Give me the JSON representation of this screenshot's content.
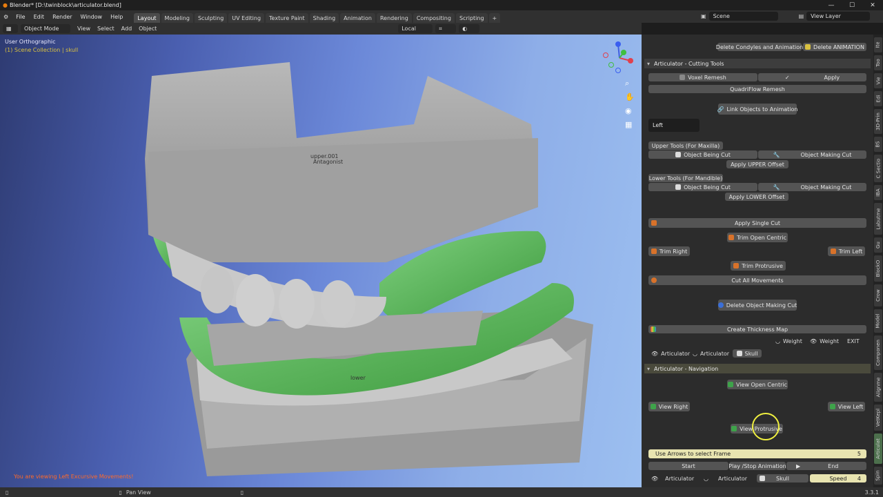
{
  "titlebar": {
    "title": "Blender* [D:\\twinblock\\articulator.blend]"
  },
  "menu": [
    "File",
    "Edit",
    "Render",
    "Window",
    "Help"
  ],
  "workspaces": [
    "Layout",
    "Modeling",
    "Sculpting",
    "UV Editing",
    "Texture Paint",
    "Shading",
    "Animation",
    "Rendering",
    "Compositing",
    "Scripting"
  ],
  "active_workspace": "Layout",
  "scene": "Scene",
  "view_layer": "View Layer",
  "toolbar": {
    "mode": "Object Mode",
    "view": "View",
    "select": "Select",
    "add": "Add",
    "object": "Object",
    "transform": "Local"
  },
  "viewport": {
    "view_name": "User Orthographic",
    "collection": "(1) Scene Collection | skull",
    "label_upper": "upper.001",
    "label_antagonist": "Antagonist",
    "label_lower": "lower",
    "status_msg": "You are viewing Left Excursive Movements!"
  },
  "cutting": {
    "top_btn1": "Delete Condyles and Animation",
    "top_btn2": "Delete ANIMATION",
    "header": "Articulator - Cutting Tools",
    "voxel": "Voxel Remesh",
    "apply": "Apply",
    "quadriflow": "QuadriFlow Remesh",
    "link": "Link Objects to Animation",
    "side": "Left",
    "upper_tools": "Upper Tools (For Maxilla)",
    "obj_being_cut": "Object Being Cut",
    "obj_making_cut": "Object Making Cut",
    "apply_upper": "Apply UPPER Offset",
    "lower_tools": "Lower Tools (For Mandible)",
    "apply_lower": "Apply LOWER Offset",
    "apply_single": "Apply Single Cut",
    "trim_open": "Trim Open Centric",
    "trim_right": "Trim Right",
    "trim_left": "Trim Left",
    "trim_protrusive": "Trim Protrusive",
    "cut_all": "Cut All Movements",
    "delete_obj": "Delete Object Making Cut",
    "thickness": "Create Thickness Map",
    "weight": "Weight",
    "exit": "EXIT",
    "articulator": "Articulator",
    "skull": "Skull"
  },
  "navigation": {
    "header": "Articulator - Navigation",
    "view_open": "View Open Centric",
    "view_right": "View Right",
    "view_left": "View Left",
    "view_protrusive": "View Protrusive",
    "frame_label": "Use Arrows to select Frame",
    "frame_value": "5",
    "start": "Start",
    "play": "Play /Stop Animation",
    "end": "End",
    "articulator": "Articulator",
    "skull": "Skull",
    "speed_label": "Speed",
    "speed_value": "4"
  },
  "vtabs": [
    "Ite",
    "Too",
    "Vie",
    "Edi",
    "3D-Prin",
    "BS",
    "C Sectio",
    "IBA",
    "Labutme",
    "Gu",
    "BlockO",
    "Crow",
    "Model",
    "Componen",
    "Alignme",
    "VetKepl",
    "Articulat",
    "Spin"
  ],
  "active_vtab": "Articulat",
  "statusbar": {
    "pan": "Pan View",
    "version": "3.3.1"
  }
}
